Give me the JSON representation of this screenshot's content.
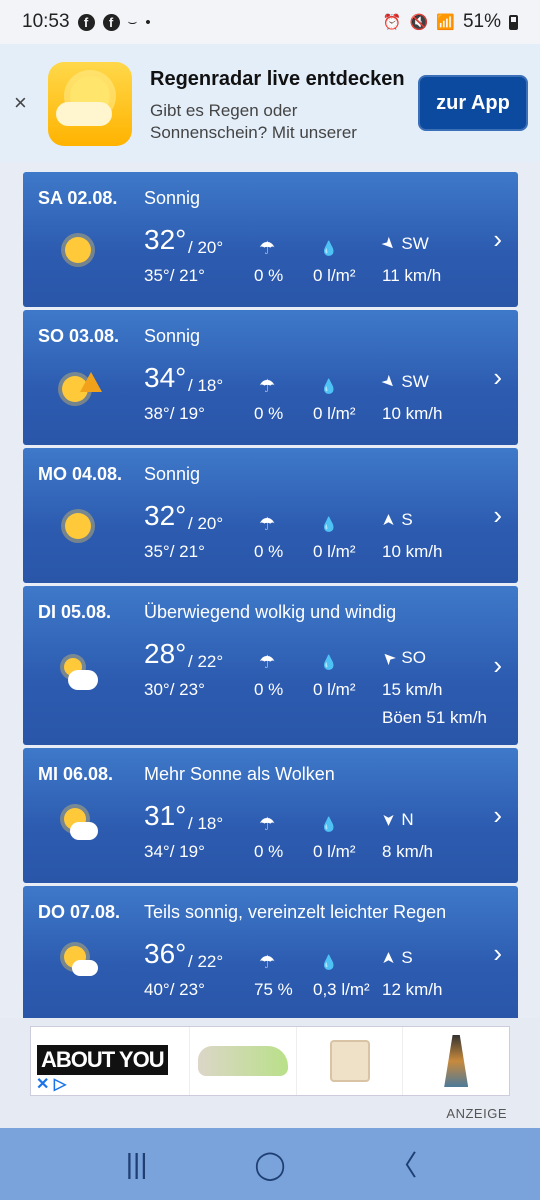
{
  "status": {
    "time": "10:53",
    "battery": "51%"
  },
  "banner": {
    "title": "Regenradar live entdecken",
    "subtitle_line1": "Gibt es Regen oder",
    "subtitle_line2": "Sonnenschein? Mit unserer",
    "button": "zur App",
    "close": "×"
  },
  "days": [
    {
      "date": "SA 02.08.",
      "cond": "Sonnig",
      "hi": "32°",
      "lo": "/ 20°",
      "feel": "35°/ 21°",
      "prob": "0 %",
      "amount": "0 l/m²",
      "dir": "SW",
      "speed": "11 km/h",
      "icon": "sun-icon"
    },
    {
      "date": "SO 03.08.",
      "cond": "Sonnig",
      "hi": "34°",
      "lo": "/ 18°",
      "feel": "38°/ 19°",
      "prob": "0 %",
      "amount": "0 l/m²",
      "dir": "SW",
      "speed": "10 km/h",
      "icon": "sun-warning-icon"
    },
    {
      "date": "MO 04.08.",
      "cond": "Sonnig",
      "hi": "32°",
      "lo": "/ 20°",
      "feel": "35°/ 21°",
      "prob": "0 %",
      "amount": "0 l/m²",
      "dir": "S",
      "speed": "10 km/h",
      "icon": "sun-icon"
    },
    {
      "date": "DI 05.08.",
      "cond": "Überwiegend wolkig und windig",
      "hi": "28°",
      "lo": "/ 22°",
      "feel": "30°/ 23°",
      "prob": "0 %",
      "amount": "0 l/m²",
      "dir": "SO",
      "speed": "15 km/h",
      "gust": "Böen 51 km/h",
      "icon": "cloud-wind-icon"
    },
    {
      "date": "MI 06.08.",
      "cond": "Mehr Sonne als Wolken",
      "hi": "31°",
      "lo": "/ 18°",
      "feel": "34°/ 19°",
      "prob": "0 %",
      "amount": "0 l/m²",
      "dir": "N",
      "speed": "8 km/h",
      "icon": "sun-cloud-icon"
    },
    {
      "date": "DO 07.08.",
      "cond": "Teils sonnig, vereinzelt leichter Regen",
      "hi": "36°",
      "lo": "/ 22°",
      "feel": "40°/ 23°",
      "prob": "75 %",
      "amount": "0,3 l/m²",
      "dir": "S",
      "speed": "12 km/h",
      "icon": "sun-rain-icon"
    }
  ],
  "ad": {
    "brand": "ABOUT YOU",
    "label": "ANZEIGE"
  }
}
